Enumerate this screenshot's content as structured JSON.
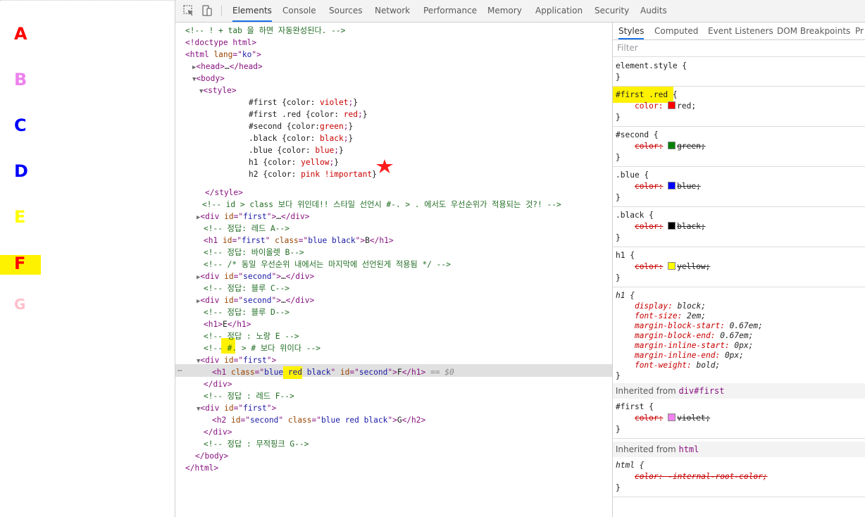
{
  "rendered": {
    "letters": [
      {
        "text": "A",
        "color": "#ff0000"
      },
      {
        "text": "B",
        "color": "#ee82ee"
      },
      {
        "text": "C",
        "color": "#0000ff"
      },
      {
        "text": "D",
        "color": "#0000ff"
      },
      {
        "text": "E",
        "color": "#ffff00"
      },
      {
        "text": "F",
        "color": "#ff0000"
      },
      {
        "text": "G",
        "color": "#ffc0cb"
      }
    ]
  },
  "toolbar": {
    "tabs": [
      "Elements",
      "Console",
      "Sources",
      "Network",
      "Performance",
      "Memory",
      "Application",
      "Security",
      "Audits"
    ],
    "active": "Elements"
  },
  "elements_lines": [
    "<!-- ! + tab 을 하면 자동완성된다. -->",
    "<!doctype html>",
    "<html lang=\"ko\">",
    "▶<head>…</head>",
    "▼<body>",
    "▼<style>",
    "#first {color: violet;}",
    "#first .red {color: red;}",
    "#second {color:green;}",
    ".black {color: black;}",
    ".blue {color: blue;}",
    "h1 {color: yellow;}",
    "h2 {color: pink !important}",
    "</style>",
    "<!-- id > class 보다 위인데!! 스타일 선언시 #-. > . 에서도 우선순위가 적용되는 것?! -->",
    "▶<div id=\"first\">…</div>",
    "<!-- 정답: 레드 A-->",
    "<h1 id=\"first\" class=\"blue black\">B</h1>",
    "<!-- 정답: 바이올렛 B-->",
    "<!-- /* 동일 우선순위 내에서는 마지막에 선언된게 적용됨 */ -->",
    "▶<div id=\"second\">…</div>",
    "<!-- 정답: 블루 C-->",
    "▶<div id=\"second\">…</div>",
    "<!-- 정답: 블루 D-->",
    "<h1>E</h1>",
    "<!-- 정답 : 노랑 E -->",
    "<!-- #. > # 보다 위이다 -->",
    "▼<div id=\"first\">",
    "<h1 class=\"blue red black\" id=\"second\">F</h1> == $0",
    "</div>",
    "<!-- 정답 : 레드 F-->",
    "▼<div id=\"first\">",
    "<h2 id=\"second\" class=\"blue red black\">G</h2>",
    "</div>",
    "<!-- 정답 : 무적핑크 G-->",
    "</body>",
    "</html>"
  ],
  "styles": {
    "subtabs": [
      "Styles",
      "Computed",
      "Event Listeners",
      "DOM Breakpoints",
      "Pr"
    ],
    "filter_placeholder": "Filter",
    "element_style": "element.style {",
    "rules": [
      {
        "selector": "#first .red {",
        "prop": "color:",
        "value": "red;",
        "swatch": "#ff0000",
        "struck": false
      },
      {
        "selector": "#second {",
        "prop": "color:",
        "value": "green;",
        "swatch": "#008000",
        "struck": true
      },
      {
        "selector": ".blue {",
        "prop": "color:",
        "value": "blue;",
        "swatch": "#0000ff",
        "struck": true
      },
      {
        "selector": ".black {",
        "prop": "color:",
        "value": "black;",
        "swatch": "#000000",
        "struck": true
      },
      {
        "selector": "h1 {",
        "prop": "color:",
        "value": "yellow;",
        "swatch": "#ffff00",
        "struck": true
      }
    ],
    "ua_rule": {
      "selector": "h1 {",
      "decls": [
        "display: block;",
        "font-size: 2em;",
        "margin-block-start: 0.67em;",
        "margin-block-end: 0.67em;",
        "margin-inline-start: 0px;",
        "margin-inline-end: 0px;",
        "font-weight: bold;"
      ]
    },
    "inherited_div_label": "Inherited from",
    "inherited_div_target": "div#first",
    "inherited_div_rule": {
      "selector": "#first {",
      "prop": "color:",
      "value": "violet;",
      "swatch": "#ee82ee"
    },
    "inherited_html_label": "Inherited from",
    "inherited_html_target": "html",
    "inherited_html_rule": {
      "selector": "html {",
      "decl": "color: -internal-root-color;"
    },
    "close_brace": "}"
  }
}
